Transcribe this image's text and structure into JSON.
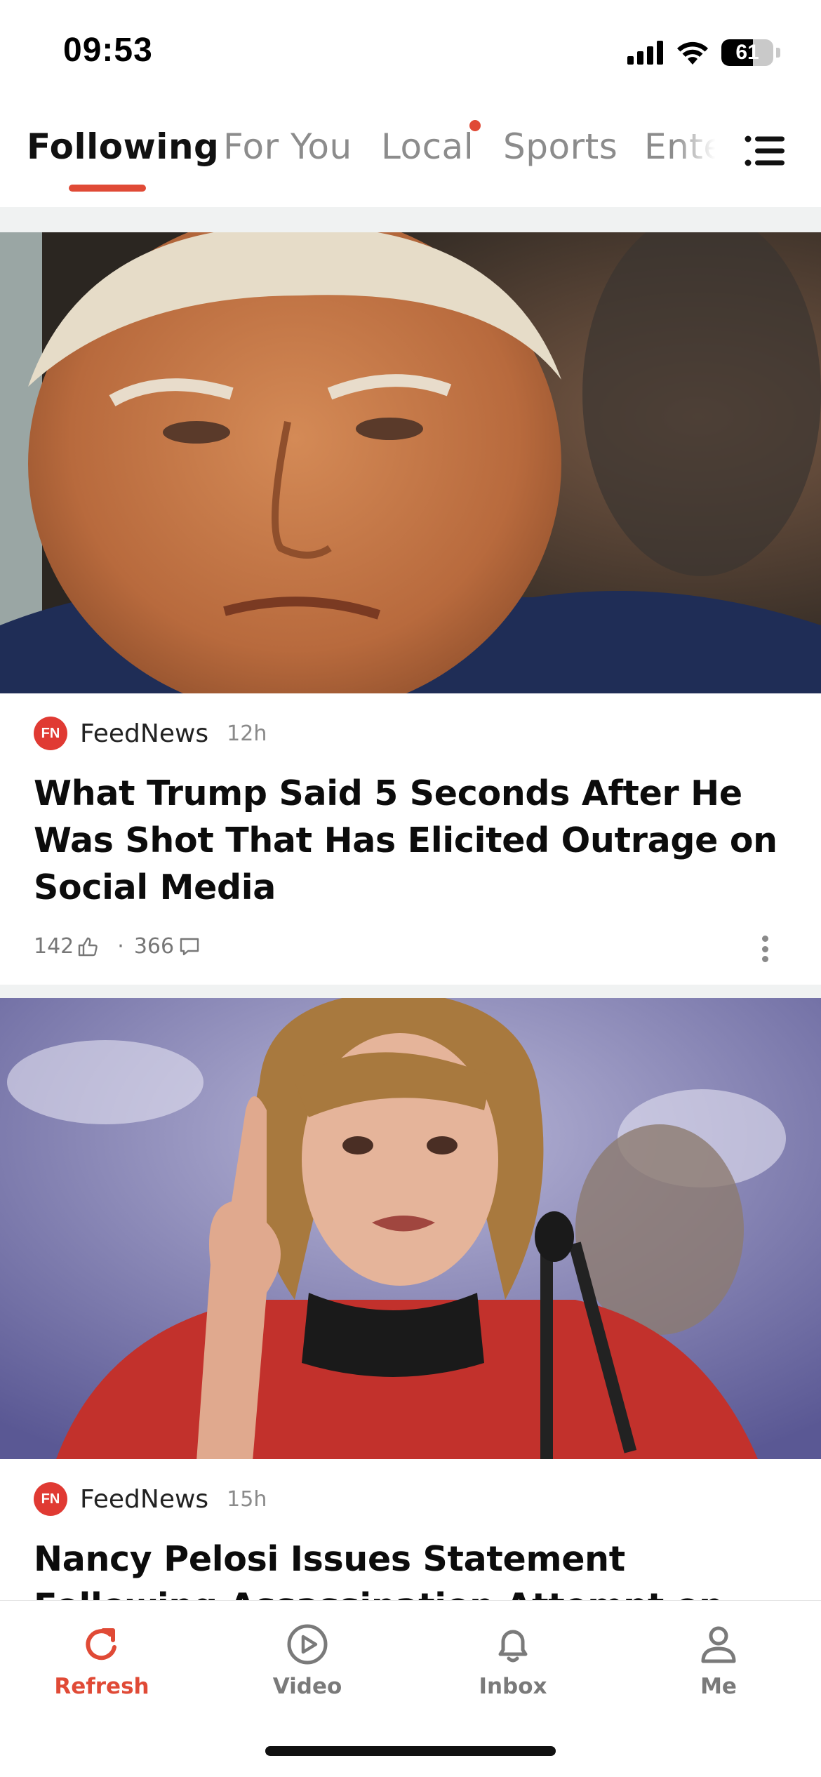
{
  "status_bar": {
    "time": "09:53",
    "battery": "61",
    "battery_level": 0.61,
    "icons": [
      "cellular-signal-icon",
      "wifi-icon",
      "battery-icon"
    ]
  },
  "tabs": [
    {
      "label": "Following",
      "active": true
    },
    {
      "label": "For You"
    },
    {
      "label": "Local",
      "badge": "dot"
    },
    {
      "label": "Sports"
    },
    {
      "label": "Enter"
    }
  ],
  "accent_color": "#e04a36",
  "articles": [
    {
      "source": "FeedNews",
      "source_logo": "FN",
      "age": "12h",
      "headline": "What Trump Said 5 Seconds After He Was Shot That Has Elicited Outrage on Social Media",
      "likes": "142",
      "comments": "366"
    },
    {
      "source": "FeedNews",
      "source_logo": "FN",
      "age": "15h",
      "headline": "Nancy Pelosi Issues Statement Following Assassination Attempt on Trump, Sparks"
    }
  ],
  "bottom_nav": [
    {
      "label": "Refresh",
      "icon": "refresh-icon",
      "active": true
    },
    {
      "label": "Video",
      "icon": "play-icon"
    },
    {
      "label": "Inbox",
      "icon": "bell-icon"
    },
    {
      "label": "Me",
      "icon": "person-icon"
    }
  ]
}
